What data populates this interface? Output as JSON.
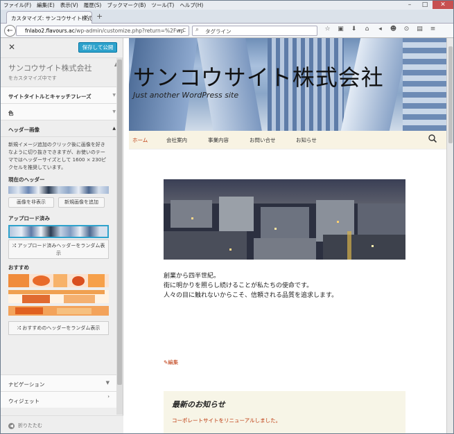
{
  "menubar": [
    "ファイル(F)",
    "編集(E)",
    "表示(V)",
    "履歴(S)",
    "ブックマーク(B)",
    "ツール(T)",
    "ヘルプ(H)"
  ],
  "window_controls": {
    "minimize": "–",
    "maximize": "□",
    "close": "✕"
  },
  "tab": {
    "title": "カスタマイズ: サンコウサイト株式...",
    "close": "×",
    "new": "+"
  },
  "address": {
    "host": "fnlabo2.flavours.ac",
    "path": "/wp-admin/customize.php?return=%2Fwp",
    "reload": "▾ C"
  },
  "search": {
    "placeholder": "タグライン"
  },
  "toolbar_icons": [
    "star-icon",
    "clipboard-icon",
    "download-icon",
    "home-icon",
    "send-icon",
    "chat-icon",
    "skype-icon",
    "camera-icon",
    "menu-icon"
  ],
  "toolbar_glyphs": [
    "☆",
    "▣",
    "⬇",
    "⌂",
    "◂",
    "☻",
    "⊙",
    "▤",
    "≡"
  ],
  "sidebar": {
    "close": "✕",
    "save": "保存して公開",
    "site_title": "サンコウサイト株式会社",
    "customizing": "をカスタマイズ中です",
    "sections": [
      {
        "label": "サイトタイトルとキャッチフレーズ"
      },
      {
        "label": "色"
      },
      {
        "label": "ヘッダー画像"
      }
    ],
    "header_image": {
      "description": "新規イメージ追加のクリック後に画像を好きなように切り抜きできますが、お使いのテーマではヘッダーサイズとして 1600 × 230ピクセルを推奨しています。",
      "current_label": "現在のヘッダー",
      "hide_button": "画像を非表示",
      "add_button": "新規画像を追加",
      "uploaded_label": "アップロード済み",
      "random_uploaded": "⤮ アップロード済みヘッダーをランダム表示",
      "suggested_label": "おすすめ",
      "random_suggested": "⤮ おすすめのヘッダーをランダム表示"
    },
    "navigation": "ナビゲーション",
    "widgets": "ウィジェット",
    "collapse": "折りたたむ"
  },
  "site": {
    "title": "サンコウサイト株式会社",
    "tagline": "Just another WordPress site",
    "menu": [
      "ホーム",
      "会社案内",
      "事業内容",
      "お問い合せ",
      "お知らせ"
    ],
    "content_lines": [
      "創業から四半世紀。",
      "街に明かりを照らし続けることが私たちの使命です。",
      "人々の目に触れないからこそ、信頼される品質を追求します。"
    ],
    "edit_link": "✎編集",
    "news_title": "最新のお知らせ",
    "news_item": "コーポレートサイトをリニューアルしました。"
  },
  "colors": {
    "accent": "#2ea2cc",
    "link": "#bc360a",
    "nav_bg": "#f8f3e3",
    "news_bg": "#f7f5e7"
  }
}
